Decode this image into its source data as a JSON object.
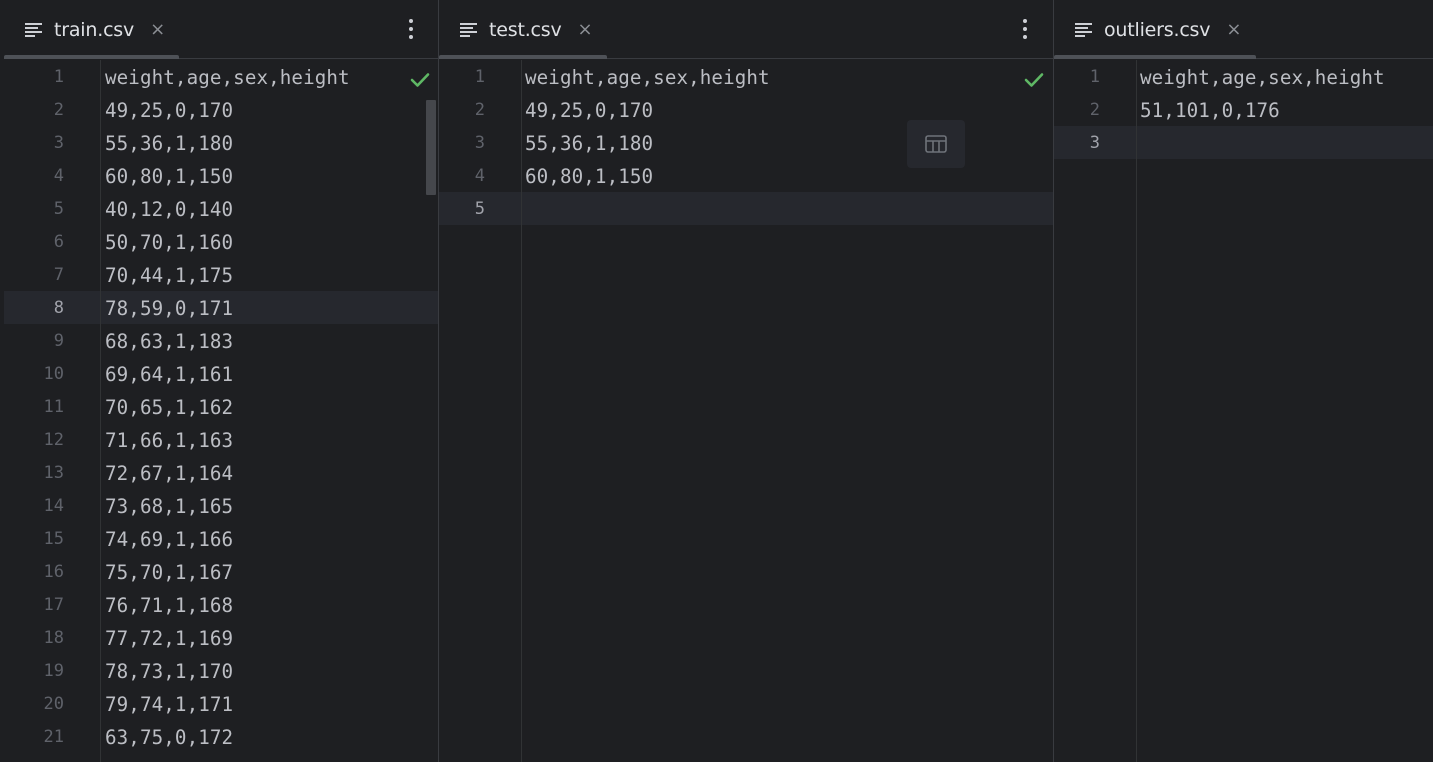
{
  "panes": [
    {
      "file_name": "train.csv",
      "close_label": "×",
      "current_line": 8,
      "lines": [
        "weight,age,sex,height",
        "49,25,0,170",
        "55,36,1,180",
        "60,80,1,150",
        "40,12,0,140",
        "50,70,1,160",
        "70,44,1,175",
        "78,59,0,171",
        "68,63,1,183",
        "69,64,1,161",
        "70,65,1,162",
        "71,66,1,163",
        "72,67,1,164",
        "73,68,1,165",
        "74,69,1,166",
        "75,70,1,167",
        "76,71,1,168",
        "77,72,1,169",
        "78,73,1,170",
        "79,74,1,171",
        "63,75,0,172"
      ]
    },
    {
      "file_name": "test.csv",
      "close_label": "×",
      "current_line": 5,
      "lines": [
        "weight,age,sex,height",
        "49,25,0,170",
        "55,36,1,180",
        "60,80,1,150",
        ""
      ]
    },
    {
      "file_name": "outliers.csv",
      "close_label": "×",
      "current_line": 3,
      "lines": [
        "weight,age,sex,height",
        "51,101,0,176",
        ""
      ]
    }
  ],
  "icons": {
    "file": "text-file-icon",
    "close": "close-icon",
    "menu": "more-vertical-icon",
    "inspection_ok": "check-icon",
    "table_view": "table-icon"
  },
  "colors": {
    "background": "#1e1f22",
    "current_line": "#26282e",
    "check": "#5fb865",
    "text": "#bcbec4",
    "line_number": "#5f626a"
  }
}
